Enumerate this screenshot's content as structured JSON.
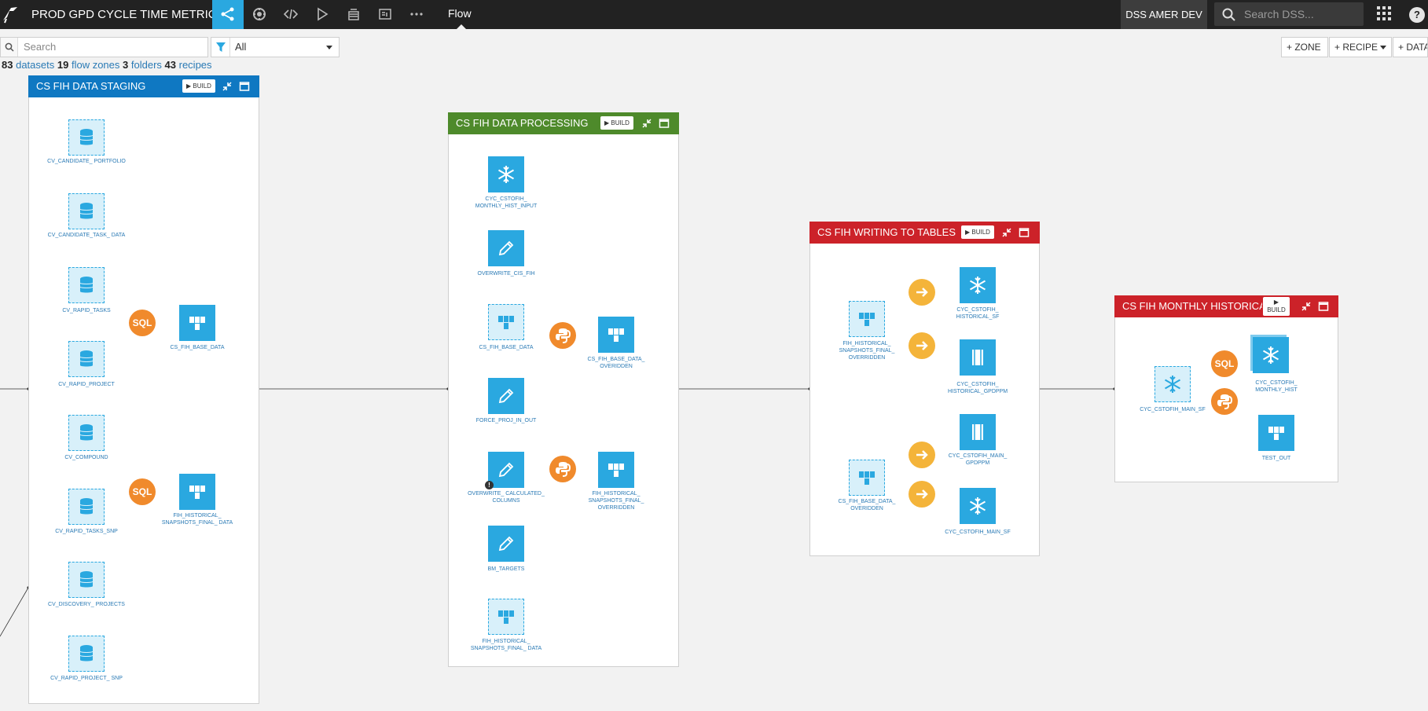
{
  "app": {
    "project_title": "PROD GPD CYCLE TIME METRICS",
    "flow_tab": "Flow",
    "instance": "DSS AMER DEV",
    "search_placeholder": "Search DSS...",
    "help": "?",
    "brand_color": "#2aa8e0"
  },
  "filter": {
    "search_placeholder": "Search",
    "selected": "All"
  },
  "actions": {
    "zone": "+ ZONE",
    "recipe": "+ RECIPE",
    "dataset": "+ DATASET"
  },
  "counts": {
    "datasets_n": "83",
    "datasets_label": "datasets",
    "zones_n": "19",
    "zones_label": "flow zones",
    "folders_n": "3",
    "folders_label": "folders",
    "recipes_n": "43",
    "recipes_label": "recipes"
  },
  "zones": [
    {
      "name": "CS FIH DATA STAGING",
      "color": "#0f78c2",
      "build": "BUILD",
      "datasets": [
        "CV_CANDIDATE_ PORTFOLIO",
        "CV_CANDIDATE_TASK_ DATA",
        "CV_RAPID_TASKS",
        "CV_RAPID_PROJECT",
        "CV_COMPOUND",
        "CV_RAPID_TASKS_SNP",
        "CV_DISCOVERY_ PROJECTS",
        "CV_RAPID_PROJECT_ SNP"
      ],
      "recipes": [
        "SQL",
        "SQL"
      ],
      "outputs": [
        "CS_FIH_BASE_DATA",
        "FIH_HISTORICAL_ SNAPSHOTS_FINAL_ DATA"
      ]
    },
    {
      "name": "CS FIH DATA PROCESSING",
      "color": "#4e8a2b",
      "build": "BUILD",
      "inputs": [
        "CYC_CSTOFIH_ MONTHLY_HIST_INPUT",
        "OVERWRITE_CIS_FIH",
        "CS_FIH_BASE_DATA",
        "FORCE_PROJ_IN_OUT",
        "OVERWRITE_ CALCULATED_ COLUMNS",
        "BM_TARGETS",
        "FIH_HISTORICAL_ SNAPSHOTS_FINAL_ DATA"
      ],
      "outputs": [
        "CS_FIH_BASE_DATA_ OVERIDDEN",
        "FIH_HISTORICAL_ SNAPSHOTS_FINAL_ OVERRIDDEN"
      ]
    },
    {
      "name": "CS FIH WRITING TO TABLES",
      "color": "#cc2229",
      "build": "BUILD",
      "inputs": [
        "FIH_HISTORICAL_ SNAPSHOTS_FINAL_ OVERRIDDEN",
        "CS_FIH_BASE_DATA_ OVERIDDEN"
      ],
      "outputs": [
        "CYC_CSTOFIH_ HISTORICAL_SF",
        "CYC_CSTOFIH_ HISTORICAL_GPDPPM",
        "CYC_CSTOFIH_MAIN_ GPDPPM",
        "CYC_CSTOFIH_MAIN_SF"
      ]
    },
    {
      "name": "CS FIH MONTHLY HISTORICA...",
      "color": "#cc2229",
      "build": "BUILD",
      "inputs": [
        "CYC_CSTOFIH_MAIN_SF"
      ],
      "recipes": [
        "SQL"
      ],
      "outputs": [
        "CYC_CSTOFIH_ MONTHLY_HIST",
        "TEST_OUT"
      ]
    }
  ]
}
